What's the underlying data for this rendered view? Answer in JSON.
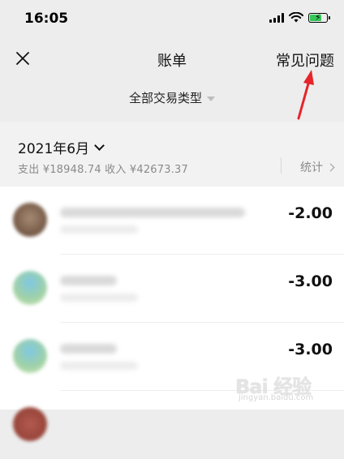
{
  "status_bar": {
    "time": "16:05"
  },
  "nav": {
    "title": "账单",
    "right_link": "常见问题"
  },
  "filter": {
    "label": "全部交易类型"
  },
  "month_header": {
    "month": "2021年6月",
    "summary": "支出 ¥18948.74 收入 ¥42673.37",
    "stats_label": "统计"
  },
  "transactions": [
    {
      "amount": "-2.00",
      "avatar": "brown"
    },
    {
      "amount": "-3.00",
      "avatar": "teal"
    },
    {
      "amount": "-3.00",
      "avatar": "teal"
    },
    {
      "amount": "",
      "avatar": "red"
    }
  ],
  "watermark": {
    "text": "Bai 经验",
    "sub": "jingyan.baidu.com"
  },
  "colors": {
    "annotation_arrow": "#e5252a",
    "battery_charge": "#34c759",
    "background": "#ededed"
  }
}
